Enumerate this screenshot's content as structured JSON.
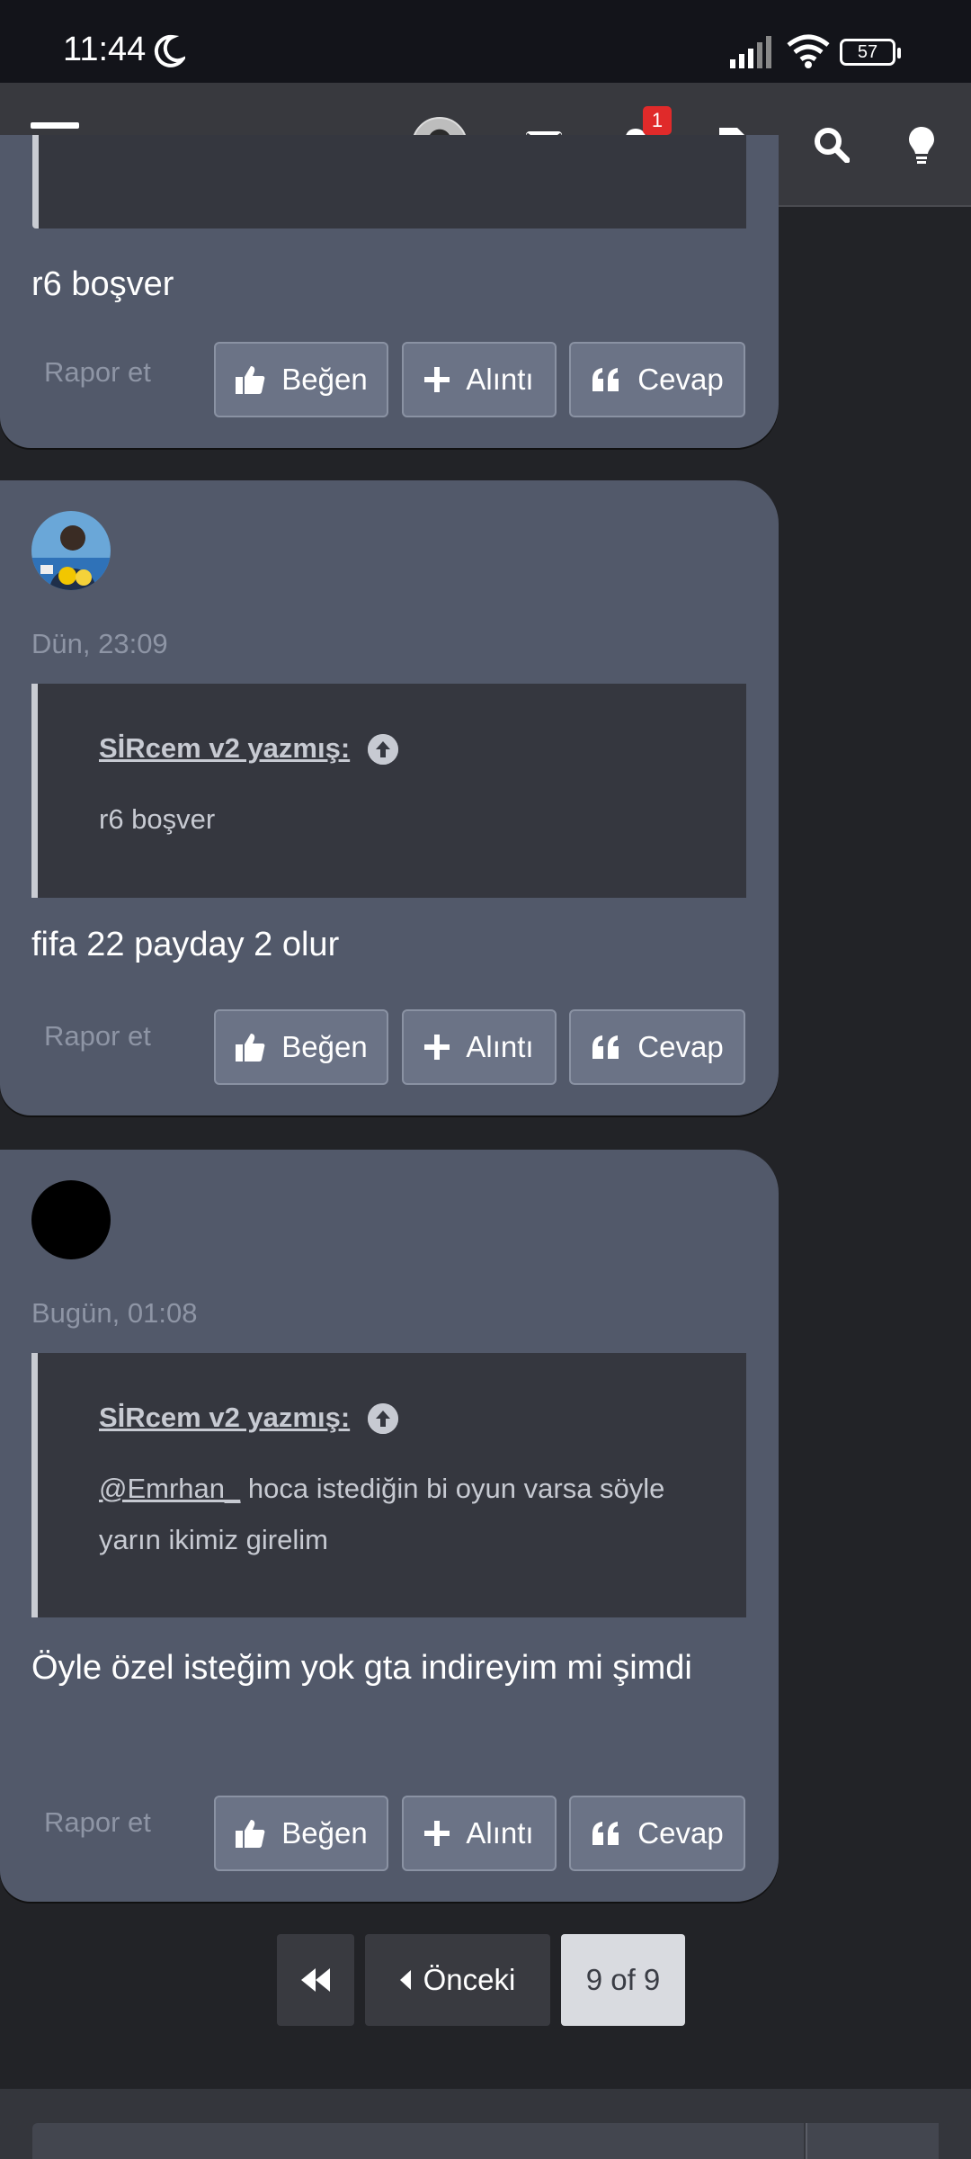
{
  "status_bar": {
    "time": "11:44",
    "battery": "57"
  },
  "navbar": {
    "notification_count": "1"
  },
  "posts": [
    {
      "message": "r6 boşver",
      "actions": {
        "report": "Rapor et",
        "like": "Beğen",
        "quote": "Alıntı",
        "reply": "Cevap"
      }
    },
    {
      "timestamp": "Dün, 23:09",
      "quote_author": "SİRcem v2 yazmış:",
      "quote_text": "r6 boşver",
      "message": "fifa 22 payday 2 olur",
      "actions": {
        "report": "Rapor et",
        "like": "Beğen",
        "quote": "Alıntı",
        "reply": "Cevap"
      }
    },
    {
      "timestamp": "Bugün, 01:08",
      "quote_author": "SİRcem v2 yazmış:",
      "quote_mention": "@Emrhan_",
      "quote_text": " hoca istediğin bi oyun varsa söyle yarın ikimiz girelim",
      "message": "Öyle özel isteğim yok gta indireyim mi şimdi",
      "actions": {
        "report": "Rapor et",
        "like": "Beğen",
        "quote": "Alıntı",
        "reply": "Cevap"
      }
    }
  ],
  "pagination": {
    "previous": "Önceki",
    "current": "9 of 9"
  },
  "icons": [
    "moon-icon",
    "signal-icon",
    "wifi-icon",
    "menu-icon",
    "mail-icon",
    "bell-icon",
    "document-icon",
    "search-icon",
    "lightbulb-icon",
    "thumbs-up-icon",
    "plus-icon",
    "quote-icon",
    "arrow-up-circle-icon",
    "rewind-icon",
    "caret-left-icon"
  ]
}
